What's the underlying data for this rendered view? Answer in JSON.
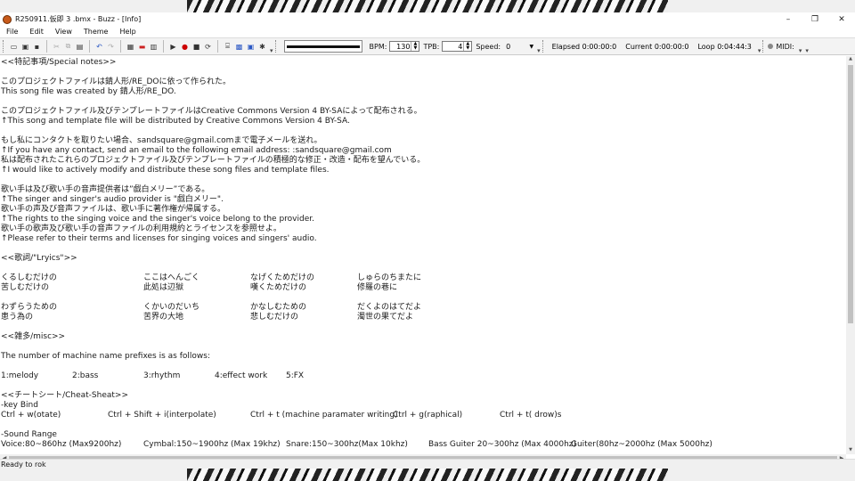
{
  "window": {
    "title": "R250911.仮即 3 .bmx - Buzz - [Info]"
  },
  "controls": {
    "minimize": "–",
    "maximize": "❐",
    "close": "✕"
  },
  "menu": [
    "File",
    "Edit",
    "View",
    "Theme",
    "Help"
  ],
  "toolbar": {
    "bpm_label": "BPM:",
    "bpm_value": "130",
    "tpb_label": "TPB:",
    "tpb_value": "4",
    "speed_label": "Speed:",
    "speed_value": "0",
    "elapsed_label": "Elapsed",
    "elapsed_value": "0:00:00:0",
    "current_label": "Current",
    "current_value": "0:00:00:0",
    "loop_label": "Loop",
    "loop_value": "0:04:44:3",
    "midi_label": "MIDI:"
  },
  "lines": [
    "<<特記事項/Special notes>>",
    "",
    "このプロジェクトファイルは錆人形/RE_DOに依って作られた。",
    "This song file was created by 錆人形/RE_DO.",
    "",
    "このプロジェクトファイル及びテンプレートファイルはCreative Commons Version 4 BY-SAによって配布される。",
    "↑This song and template file will be distributed by Creative Commons Version 4 BY-SA.",
    "",
    "もし私にコンタクトを取りたい場合、sandsquare@gmail.comまで電子メールを送れ。",
    "↑If you have any contact, send an email to the following email address: :sandsquare@gmail.com",
    "私は配布されたこれらのプロジェクトファイル及びテンプレートファイルの積極的な修正・改造・配布を望んでいる。",
    "↑I would like to actively modify and distribute these song files and template files.",
    "",
    "歌い手は及び歌い手の音声提供者は”戯白メリー”である。",
    "↑The singer and singer's audio provider is \"戯白メリー\".",
    "歌い手の声及び音声ファイルは、歌い手に著作権が帰属する。",
    "↑The rights to the singing voice and the singer's voice belong to the provider.",
    "歌い手の歌声及び歌い手の音声ファイルの利用規約とライセンスを参照せよ。",
    "↑Please refer to their terms and licenses for singing voices and singers' audio.",
    "",
    "<<歌詞/\"Lryics\">>"
  ],
  "lyrics": [
    [
      "くるしむだけの",
      "ここはへんごく",
      "なげくためだけの",
      "しゅらのちまたに"
    ],
    [
      "苦しむだけの",
      "此処は辺獄",
      "嘆くためだけの",
      "修羅の巷に"
    ],
    [
      "",
      "",
      "",
      ""
    ],
    [
      "わずらうための",
      "くかいのだいち",
      "かなしむための",
      "だくよのはてだよ"
    ],
    [
      "患う為の",
      "苦界の大地",
      "悲しむだけの",
      "濁世の果てだよ"
    ]
  ],
  "misc_header": "<<雑多/misc>>",
  "prefix_intro": "The number of machine name prefixes is as follows:",
  "prefixes": [
    "1:melody",
    "2:bass",
    "3:rhythm",
    "4:effect work",
    "5:FX"
  ],
  "cheat_header": "<<チートシート/Cheat-Sheat>>",
  "keybind_header": "-key Bind",
  "keybinds": [
    "Ctrl + w(otate)",
    "Ctrl + Shift + i(interpolate)",
    "Ctrl + t (machine paramater writing)",
    "Ctrl + g(raphical)",
    "Ctrl + t( drow)s"
  ],
  "sound_header": "-Sound Range",
  "ranges": [
    "Voice:80~860hz (Max9200hz)",
    "Cymbal:150~1900hz (Max 19khz)",
    "Snare:150~300hz(Max 10khz)",
    "Bass Guiter 20~300hz (Max 4000hz)",
    "Guiter(80hz~2000hz (Max 5000hz)"
  ],
  "status": "Ready to rok"
}
